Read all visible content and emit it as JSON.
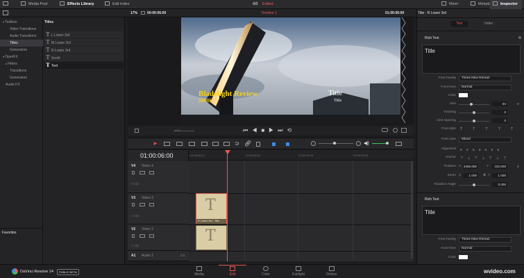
{
  "topbar": {
    "media_pool": "Media Pool",
    "effects_library": "Effects Library",
    "edit_index": "Edit Index",
    "project_name": "dd",
    "project_status": "Edited",
    "mixer": "Mixer",
    "metadata": "Metadata",
    "inspector": "Inspector"
  },
  "viewer_bar": {
    "zoom": "17%",
    "source_tc": "00:00:06:00",
    "timeline_name": "Timeline 1",
    "record_tc": "01:00:06:00"
  },
  "tree": {
    "items": [
      "Toolbox",
      "Video Transitions",
      "Audio Transitions",
      "Titles",
      "Generators",
      "OpenFX",
      "Filters",
      "Transitions",
      "Generators",
      "Audio FX"
    ],
    "favorites": "Favorites"
  },
  "titles_panel": {
    "header": "Titles",
    "items": [
      "L Lower 3rd",
      "M Lower 3rd",
      "R Lower 3rd",
      "Scroll",
      "Text"
    ]
  },
  "video": {
    "headline": "Bladelight Review",
    "subline": "3400k",
    "title_right": "Title",
    "subtitle_right": "Title"
  },
  "timeline": {
    "timecode": "01:00:06:00",
    "ruler": [
      "01:00:00:12",
      "01:00:08:18",
      "01:00:16:16",
      "01:00:25:20"
    ],
    "tracks": [
      {
        "id": "V4",
        "name": "Video 4",
        "count": "0 Clip"
      },
      {
        "id": "V3",
        "name": "Video 3",
        "count": "1 Clip"
      },
      {
        "id": "V2",
        "name": "Video 2",
        "count": "1 Clip"
      },
      {
        "id": "A1",
        "name": "Audio 1",
        "count": "2.0"
      }
    ],
    "clip_label": "R Lower 3rd - Title"
  },
  "inspector": {
    "title": "Title - R Lower 3rd",
    "tabs": [
      "Text",
      "Video"
    ],
    "section1": "Rich Text",
    "text_value": "Title",
    "font_family_label": "Font Family",
    "font_family": "Times New Roman",
    "font_face_label": "Font Face",
    "font_face": "Normal",
    "color_label": "Color",
    "size_label": "Size",
    "size": "94",
    "tracking_label": "Tracking",
    "tracking": "0",
    "line_spacing_label": "Line Spacing",
    "line_spacing": "0",
    "font_style_label": "Font style",
    "font_case_label": "Font case",
    "font_case": "Mixed",
    "alignment_label": "Alignment",
    "anchor_label": "Anchor",
    "position_label": "Position",
    "position_x_label": "X",
    "position_x": "3456.000",
    "position_y_label": "Y",
    "position_y": "432.000",
    "zoom_label": "Zoom",
    "zoom_x_label": "X",
    "zoom_x": "1.000",
    "zoom_y_label": "Y",
    "zoom_y": "1.000",
    "rotation_label": "Rotation Angle",
    "rotation": "0.000",
    "section2": "Rich Text",
    "text_value2": "Title",
    "font_family2": "Times New Roman",
    "font_face2": "Normal",
    "accent": "#e85a4f"
  },
  "bottombar": {
    "app_name": "DaVinci Resolve 14",
    "badge": "PUBLIC BETA",
    "pages": [
      "Media",
      "Edit",
      "Color",
      "Fairlight",
      "Deliver"
    ],
    "watermark": "wvideo.com"
  }
}
